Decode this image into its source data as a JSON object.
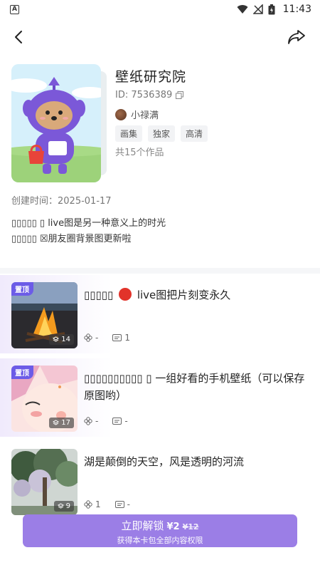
{
  "status": {
    "time": "11:43",
    "app_icon": "A"
  },
  "header": {
    "title": "壁纸研究院",
    "id": "ID: 7536389",
    "author": "小禄满",
    "tags": [
      "画集",
      "独家",
      "高清"
    ],
    "count": "共15个作品",
    "created": "创建时间：2025-01-17",
    "desc_line1": "▯▯▯▯▯ ▯ live图是另一种意义上的时光",
    "desc_line2": "▯▯▯▯▯ ☒朋友圈背景图更新啦"
  },
  "items": [
    {
      "pinned": true,
      "pin_label": "置顶",
      "title_prefix": "▯▯▯▯▯",
      "title_suffix": "live图把片刻变永久",
      "images": "14",
      "likes": "-",
      "comments": "1"
    },
    {
      "pinned": true,
      "pin_label": "置顶",
      "title": "▯▯▯▯▯▯▯▯▯▯ ▯ 一组好看的手机壁纸（可以保存原图哟）",
      "images": "17",
      "likes": "-",
      "comments": "-"
    },
    {
      "pinned": false,
      "title": "湖是颠倒的天空，风是透明的河流",
      "images": "9",
      "likes": "1",
      "comments": "-"
    }
  ],
  "unlock": {
    "label": "立即解锁",
    "price": "¥2",
    "orig_price": "¥12",
    "subtitle": "获得本卡包全部内容权限"
  },
  "colors": {
    "accent": "#9b7ee6",
    "pin": "#6c5ce7"
  }
}
